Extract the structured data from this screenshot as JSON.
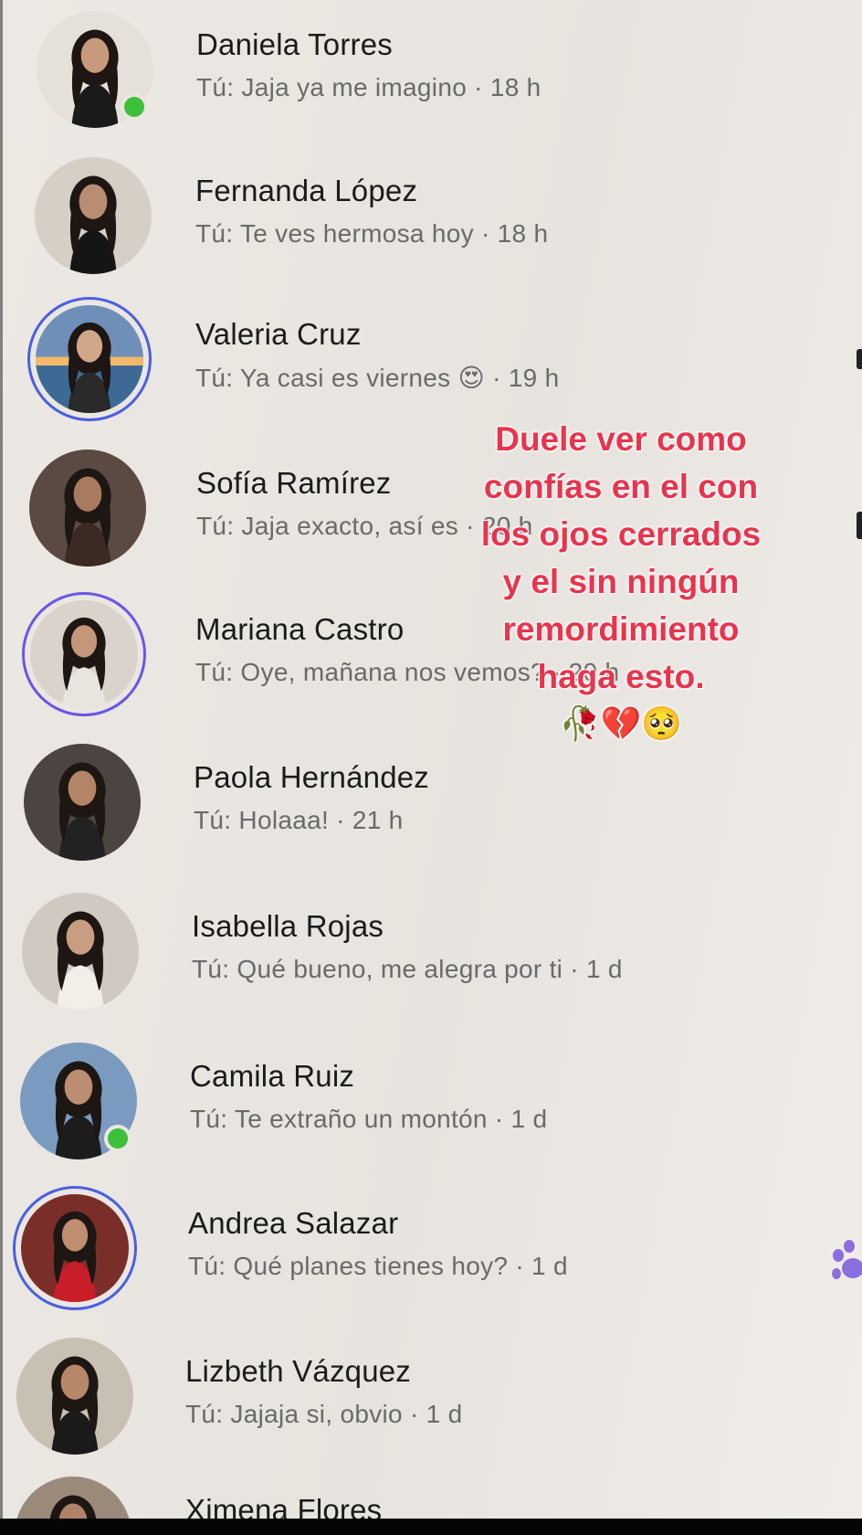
{
  "conversations": [
    {
      "name": "Daniela Torres",
      "preview": "Tú: Jaja ya me imagino · 18 h",
      "online": true,
      "story": false
    },
    {
      "name": "Fernanda López",
      "preview": "Tú: Te ves hermosa hoy · 18 h",
      "online": false,
      "story": false
    },
    {
      "name": "Valeria Cruz",
      "preview": "Tú: Ya casi es viernes 😍 · 19 h",
      "online": false,
      "story": true
    },
    {
      "name": "Sofía Ramírez",
      "preview": "Tú: Jaja exacto, así es · 20 h",
      "online": false,
      "story": false
    },
    {
      "name": "Mariana Castro",
      "preview": "Tú: Oye, mañana nos vemos? · 20 h",
      "online": false,
      "story": true
    },
    {
      "name": "Paola Hernández",
      "preview": "Tú: Holaaa! · 21 h",
      "online": false,
      "story": false
    },
    {
      "name": "Isabella Rojas",
      "preview": "Tú: Qué bueno, me alegra por ti · 1 d",
      "online": false,
      "story": false
    },
    {
      "name": "Camila Ruiz",
      "preview": "Tú: Te extraño un montón · 1 d",
      "online": true,
      "story": false
    },
    {
      "name": "Andrea Salazar",
      "preview": "Tú: Qué planes tienes hoy? · 1 d",
      "online": false,
      "story": true
    },
    {
      "name": "Lizbeth Vázquez",
      "preview": "Tú: Jajaja si, obvio · 1 d",
      "online": false,
      "story": false
    },
    {
      "name": "Ximena Flores",
      "preview": "",
      "online": false,
      "story": false
    }
  ],
  "overlay": {
    "lines": [
      "Duele ver como",
      "confías en el con",
      "los ojos cerrados",
      "y el sin ningún",
      "remordimiento",
      "haga esto."
    ],
    "emojis": "🥀💔🥺"
  },
  "colors": {
    "background": "#eae6e1",
    "overlay_text": "#e8344e",
    "online": "#3cbf3a",
    "story_ring": "#4a5fe0"
  }
}
